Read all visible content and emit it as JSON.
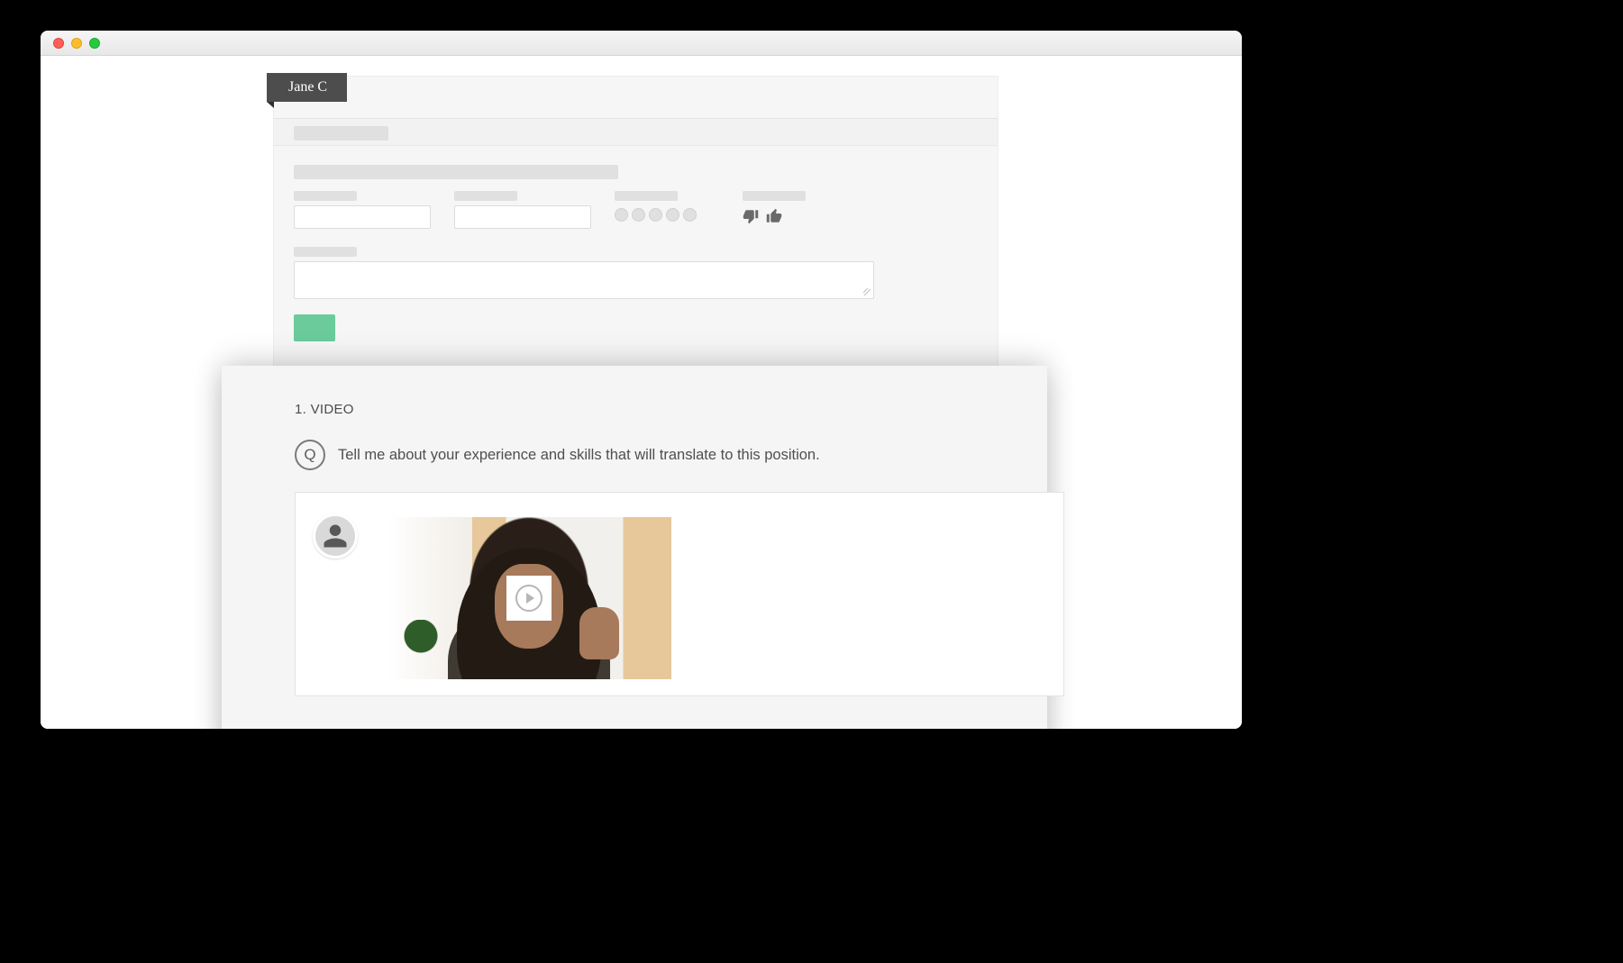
{
  "window": {
    "platform": "macOS"
  },
  "candidate": {
    "name": "Jane C"
  },
  "question_section": {
    "index_label": "1. VIDEO",
    "question_badge": "Q",
    "question_text": "Tell me about your experience and skills that will translate to this position."
  },
  "icons": {
    "thumbs_down": "thumbs-down-icon",
    "thumbs_up": "thumbs-up-icon",
    "avatar": "person-silhouette-icon",
    "play": "play-icon"
  },
  "colors": {
    "tag_bg": "#4d4d4d",
    "accent": "#6bcb9a",
    "panel_bg": "#f5f5f5"
  },
  "form_skeleton": {
    "rating_dot_count": 5
  }
}
